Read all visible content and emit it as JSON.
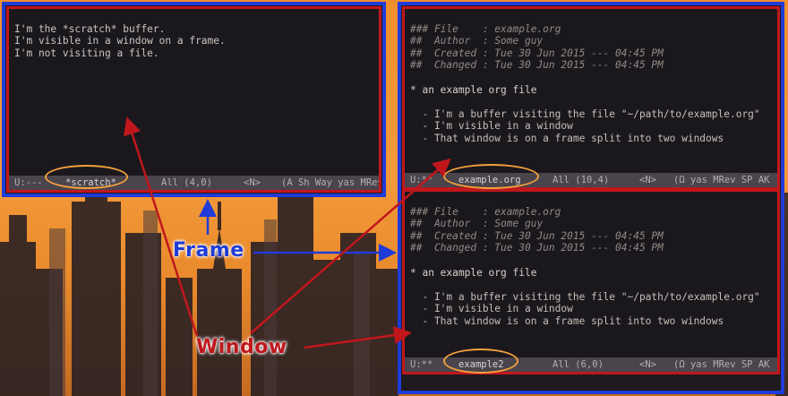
{
  "scratch": {
    "lines": [
      "I'm the *scratch* buffer.",
      "I'm visible in a window on a frame.",
      "I'm not visiting a file."
    ],
    "modeline": {
      "state": "U:---",
      "buffer": "*scratch*",
      "position": "All (4,0)",
      "mode": "<N>",
      "rest": "(A Sh Way yas MRev"
    }
  },
  "org_window_top": {
    "header": [
      "### File    : example.org",
      "##  Author  : Some guy",
      "##  Created : Tue 30 Jun 2015 --- 04:45 PM",
      "##  Changed : Tue 30 Jun 2015 --- 04:45 PM"
    ],
    "heading": "* an example org file",
    "items": [
      "  - I'm a buffer visiting the file \"~/path/to/example.org\"",
      "  - I'm visible in a window",
      "  - That window is on a frame split into two windows"
    ],
    "modeline": {
      "state": "U:**",
      "buffer": "example.org",
      "position": "All (10,4)",
      "mode": "<N>",
      "rest": "(Ω yas MRev SP AK"
    }
  },
  "org_window_bottom": {
    "header": [
      "### File    : example.org",
      "##  Author  : Some guy",
      "##  Created : Tue 30 Jun 2015 --- 04:45 PM",
      "##  Changed : Tue 30 Jun 2015 --- 04:45 PM"
    ],
    "heading": "* an example org file",
    "items": [
      "  - I'm a buffer visiting the file \"~/path/to/example.org\"",
      "  - I'm visible in a window",
      "  - That window is on a frame split into two windows"
    ],
    "modeline": {
      "state": "U:**",
      "buffer": "example2",
      "position": "All (6,0)",
      "mode": "<N>",
      "rest": "(Ω yas MRev SP AK"
    }
  },
  "annotations": {
    "frame_label": "Frame",
    "window_label": "Window"
  },
  "colors": {
    "frame_border": "#1f3bd8",
    "window_border": "#c0171c",
    "buffer_highlight": "#f3a13d",
    "sky": "#f08f2e"
  }
}
